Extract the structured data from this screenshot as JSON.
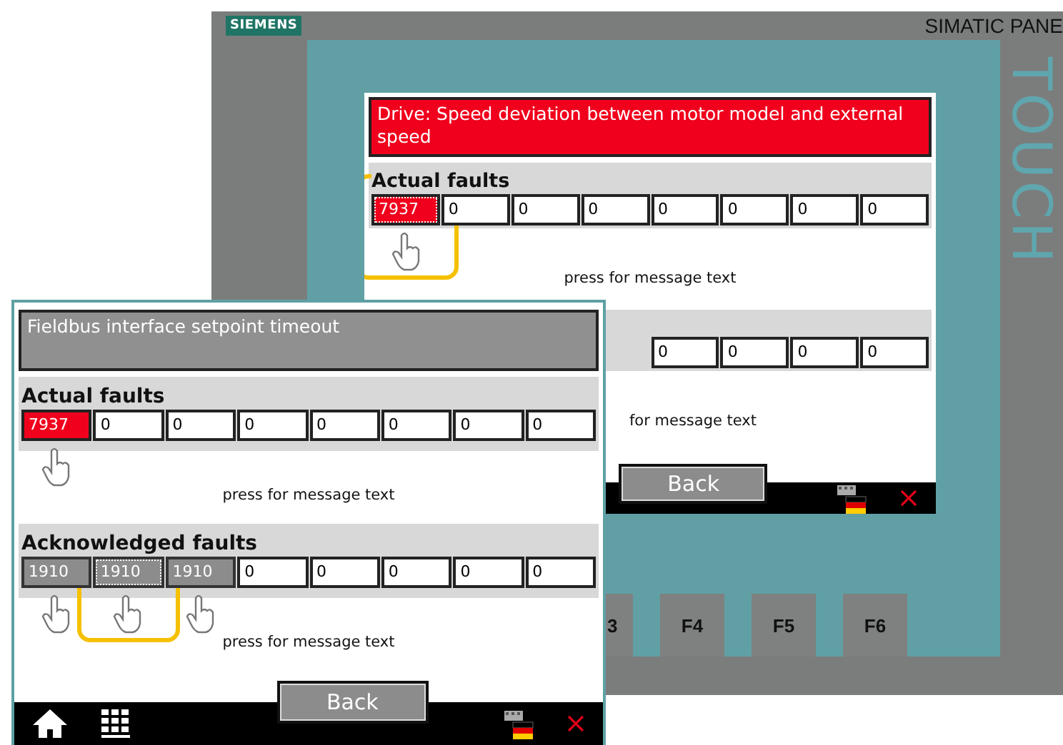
{
  "background_panel": {
    "brand": "SIEMENS",
    "model": "SIMATIC PANE",
    "touch_label": "TOUCH",
    "screen": {
      "message": {
        "text": "Drive: Speed deviation between motor model and external speed",
        "alarm": true
      },
      "sections": [
        {
          "title": "Actual faults",
          "hint": "press for message text",
          "cells": [
            {
              "value": "7937",
              "kind": "active",
              "focused": true,
              "pointer": true,
              "highlighted": true
            },
            {
              "value": "0",
              "kind": "empty",
              "focused": false,
              "pointer": false,
              "highlighted": false
            },
            {
              "value": "0",
              "kind": "empty",
              "focused": false,
              "pointer": false,
              "highlighted": false
            },
            {
              "value": "0",
              "kind": "empty",
              "focused": false,
              "pointer": false,
              "highlighted": false
            },
            {
              "value": "0",
              "kind": "empty",
              "focused": false,
              "pointer": false,
              "highlighted": false
            },
            {
              "value": "0",
              "kind": "empty",
              "focused": false,
              "pointer": false,
              "highlighted": false
            },
            {
              "value": "0",
              "kind": "empty",
              "focused": false,
              "pointer": false,
              "highlighted": false
            },
            {
              "value": "0",
              "kind": "empty",
              "focused": false,
              "pointer": false,
              "highlighted": false
            }
          ]
        },
        {
          "hint": "for message text",
          "cells": [
            {
              "value": "0",
              "kind": "empty",
              "focused": false,
              "pointer": false,
              "highlighted": false
            },
            {
              "value": "0",
              "kind": "empty",
              "focused": false,
              "pointer": false,
              "highlighted": false
            },
            {
              "value": "0",
              "kind": "empty",
              "focused": false,
              "pointer": false,
              "highlighted": false
            },
            {
              "value": "0",
              "kind": "empty",
              "focused": false,
              "pointer": false,
              "highlighted": false
            }
          ]
        }
      ],
      "back_button": "Back",
      "bar_icons": [
        {
          "kind": "flag"
        },
        {
          "kind": "close"
        }
      ]
    },
    "function_keys": [
      "3",
      "F4",
      "F5",
      "F6"
    ]
  },
  "front_window": {
    "message": {
      "text": "Fieldbus interface setpoint timeout",
      "alarm": false
    },
    "sections": [
      {
        "title": "Actual faults",
        "hint": "press for message text",
        "cells": [
          {
            "value": "7937",
            "kind": "active",
            "focused": false,
            "pointer": true,
            "highlighted": false
          },
          {
            "value": "0",
            "kind": "empty",
            "focused": false,
            "pointer": false,
            "highlighted": false
          },
          {
            "value": "0",
            "kind": "empty",
            "focused": false,
            "pointer": false,
            "highlighted": false
          },
          {
            "value": "0",
            "kind": "empty",
            "focused": false,
            "pointer": false,
            "highlighted": false
          },
          {
            "value": "0",
            "kind": "empty",
            "focused": false,
            "pointer": false,
            "highlighted": false
          },
          {
            "value": "0",
            "kind": "empty",
            "focused": false,
            "pointer": false,
            "highlighted": false
          },
          {
            "value": "0",
            "kind": "empty",
            "focused": false,
            "pointer": false,
            "highlighted": false
          },
          {
            "value": "0",
            "kind": "empty",
            "focused": false,
            "pointer": false,
            "highlighted": false
          }
        ]
      },
      {
        "title": "Acknowledged faults",
        "hint": "press for message text",
        "cells": [
          {
            "value": "1910",
            "kind": "acknowledged",
            "focused": false,
            "pointer": true,
            "highlighted": false
          },
          {
            "value": "1910",
            "kind": "acknowledged",
            "focused": true,
            "pointer": true,
            "highlighted": true
          },
          {
            "value": "1910",
            "kind": "acknowledged",
            "focused": false,
            "pointer": true,
            "highlighted": false
          },
          {
            "value": "0",
            "kind": "empty",
            "focused": false,
            "pointer": false,
            "highlighted": false
          },
          {
            "value": "0",
            "kind": "empty",
            "focused": false,
            "pointer": false,
            "highlighted": false
          },
          {
            "value": "0",
            "kind": "empty",
            "focused": false,
            "pointer": false,
            "highlighted": false
          },
          {
            "value": "0",
            "kind": "empty",
            "focused": false,
            "pointer": false,
            "highlighted": false
          },
          {
            "value": "0",
            "kind": "empty",
            "focused": false,
            "pointer": false,
            "highlighted": false
          }
        ]
      }
    ],
    "back_button": "Back",
    "bar_icons": [
      {
        "kind": "home"
      },
      {
        "kind": "keypad"
      },
      {
        "kind": "flag"
      },
      {
        "kind": "close"
      }
    ]
  }
}
